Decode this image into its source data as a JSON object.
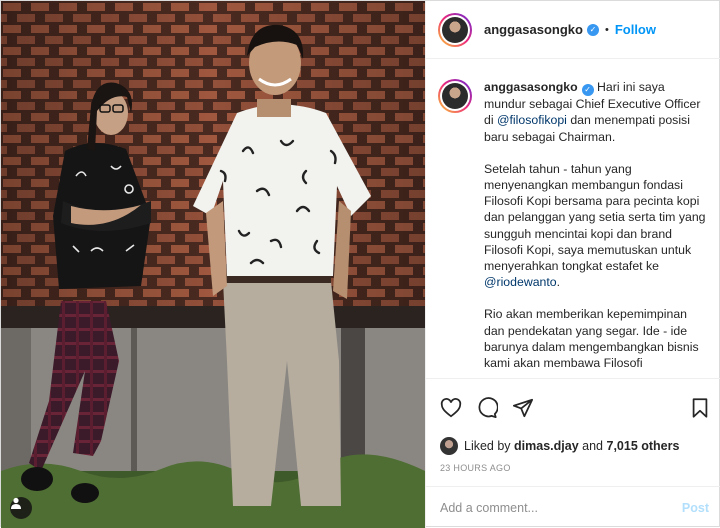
{
  "post": {
    "username": "anggasasongko",
    "dot": "•",
    "follow_label": "Follow",
    "caption": {
      "p1_before": "Hari ini saya mundur sebagai Chief Executive Officer di ",
      "p1_mention": "@filosofikopi",
      "p1_after": " dan menempati posisi baru sebagai Chairman.",
      "p2_before": "Setelah tahun - tahun yang menyenangkan membangun fondasi Filosofi Kopi bersama para pecinta kopi dan pelanggan yang setia serta tim yang sungguh mencintai kopi dan brand Filosofi Kopi, saya memutuskan untuk menyerahkan tongkat estafet ke ",
      "p2_mention": "@riodewanto",
      "p2_after": ".",
      "p3": "Rio akan memberikan kepemimpinan dan pendekatan yang segar. Ide - ide barunya dalam mengembangkan bisnis kami akan membawa Filosofi"
    },
    "likes": {
      "prefix": "Liked by",
      "user": "dimas.djay",
      "mid": "and",
      "count": "7,015 others"
    },
    "timestamp": "23 HOURS AGO",
    "comment_placeholder": "Add a comment...",
    "post_label": "Post"
  },
  "icons": {
    "verified": "verified-badge-icon",
    "like": "heart-icon",
    "comment": "comment-icon",
    "share": "paper-plane-icon",
    "save": "bookmark-icon",
    "tag": "user-tag-icon"
  },
  "colors": {
    "accent": "#0095f6",
    "mention": "#00376b",
    "verified": "#3897f0",
    "muted": "#8e8e8e",
    "post_disabled": "#b2dffc"
  }
}
